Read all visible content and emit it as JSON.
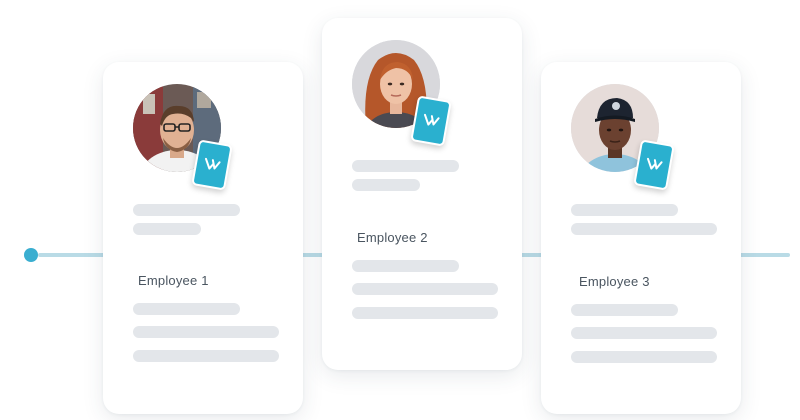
{
  "colors": {
    "accent": "#2ab0cf",
    "timeline": "#b9dbe6",
    "placeholder_bar": "#e3e6ea",
    "card_bg": "#ffffff",
    "text": "#4a5560"
  },
  "timeline": {
    "icon": "timeline-start-dot"
  },
  "employees": [
    {
      "name": "Employee 1",
      "avatar_icon": "employee-photo",
      "badge_icon": "verified-check-icon"
    },
    {
      "name": "Employee 2",
      "avatar_icon": "employee-photo",
      "badge_icon": "verified-check-icon"
    },
    {
      "name": "Employee 3",
      "avatar_icon": "employee-photo",
      "badge_icon": "verified-check-icon"
    }
  ]
}
